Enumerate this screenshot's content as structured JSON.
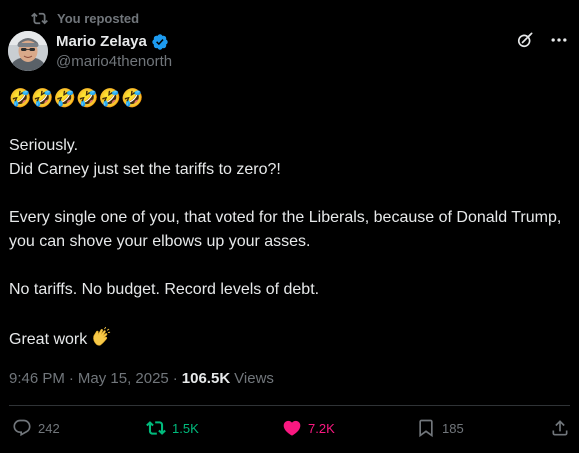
{
  "repost_banner": {
    "text": "You reposted",
    "icon": "repost-icon"
  },
  "author": {
    "name": "Mario Zelaya",
    "handle": "@mario4thenorth",
    "verified_icon": "verified-badge-icon",
    "verified_color": "#1d9bf0"
  },
  "top_actions": {
    "grok_icon": "grok-icon",
    "more_icon": "more-icon"
  },
  "post": {
    "emoji_line": "🤣🤣🤣🤣🤣🤣",
    "line1": "Seriously.",
    "line2": "Did Carney just set the tariffs to zero?!",
    "paragraph2": "Every single one of you, that voted for the Liberals, because of Donald Trump, you can shove your elbows up your asses.",
    "paragraph3": "No tariffs. No budget. Record levels of debt.",
    "closing": "Great work",
    "closing_emoji": "clapping-hands-icon"
  },
  "meta": {
    "time": "9:46 PM",
    "separator1": "·",
    "date": "May 15, 2025",
    "separator2": "·",
    "views_count": "106.5K",
    "views_label": "Views"
  },
  "actions": {
    "reply_count": "242",
    "repost_count": "1.5K",
    "like_count": "7.2K",
    "bookmark_count": "185"
  },
  "colors": {
    "background": "#000000",
    "text": "#e7e9ea",
    "muted": "#71767b",
    "repost_active": "#00ba7c",
    "like_active": "#f91880",
    "divider": "#2f3336"
  }
}
